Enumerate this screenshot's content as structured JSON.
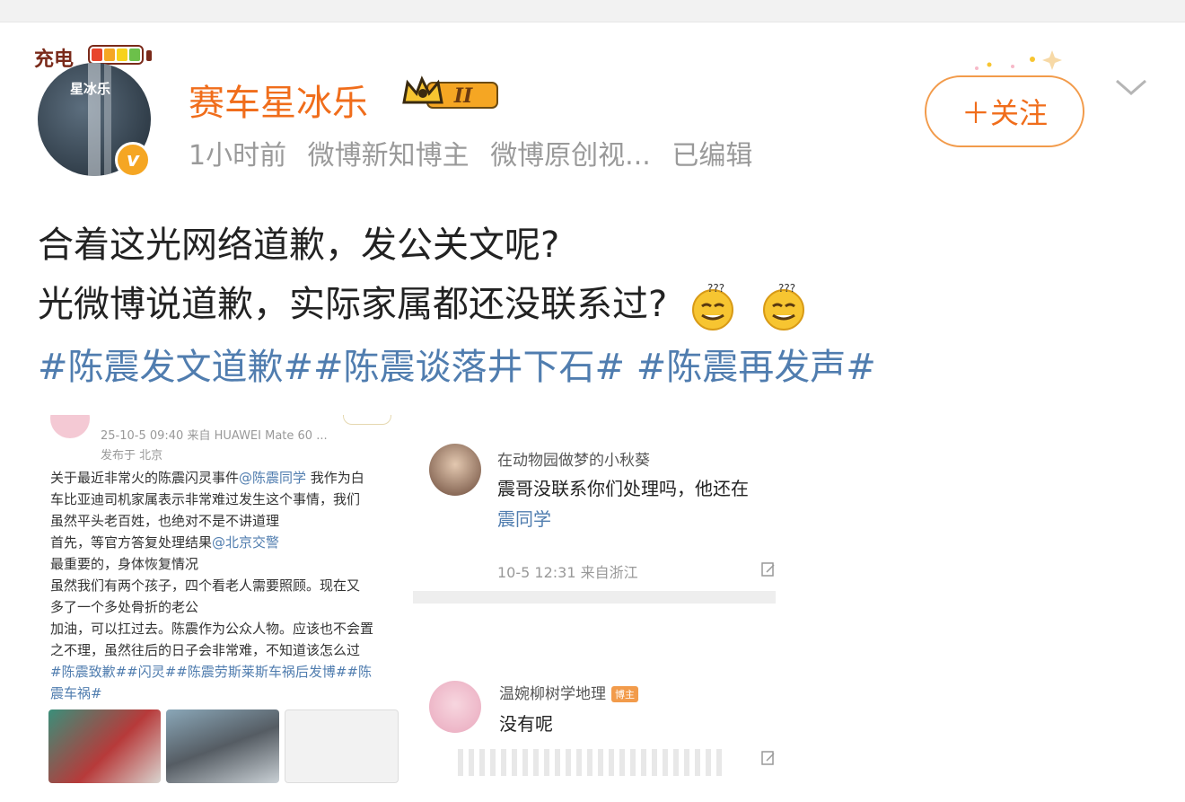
{
  "header": {
    "charging_label": "充电",
    "avatar_text": "星冰乐",
    "username": "赛车星冰乐",
    "rank_badge": "II",
    "verified_mark": "v",
    "meta": [
      "1小时前",
      "微博新知博主",
      "微博原创视...",
      "已编辑"
    ],
    "follow_label": "＋关注",
    "accent_color": "#f06d1b"
  },
  "post": {
    "line1": "合着这光网络道歉，发公关文呢?",
    "line2": "光微博说道歉，实际家属都还没联系过?",
    "hashtags": "#陈震发文道歉##陈震谈落井下石# #陈震再发声#",
    "link_color": "#507daf"
  },
  "left_screenshot": {
    "meta": "25-10-5 09:40  来自 HUAWEI Mate 60 ...",
    "location": "发布于 北京",
    "l1a": "关于最近非常火的陈震闪灵事件",
    "l1_mention": "@陈震同学",
    "l1b": " 我作为白",
    "l2": "车比亚迪司机家属表示非常难过发生这个事情，我们",
    "l3": "虽然平头老百姓，也绝对不是不讲道理",
    "l4a": "首先，等官方答复处理结果",
    "l4_mention": "@北京交警",
    "l5": "最重要的，身体恢复情况",
    "l6": "虽然我们有两个孩子，四个看老人需要照顾。现在又",
    "l7": "多了一个多处骨折的老公",
    "l8": "加油，可以扛过去。陈震作为公众人物。应该也不会置",
    "l9": "之不理，虽然往后的日子会非常难，不知道该怎么过",
    "l10": "#陈震致歉##闪灵##陈震劳斯莱斯车祸后发博##陈",
    "l11": "震车祸#"
  },
  "right_screenshot": {
    "c1_name": "在动物园做梦的小秋葵",
    "c1_text": "震哥没联系你们处理吗，他还在",
    "c1_link": "震同学",
    "c1_time": "10-5 12:31  来自浙江",
    "c2_name": "温婉柳树学地理",
    "c2_badge": "博主",
    "c2_text": "没有呢"
  }
}
